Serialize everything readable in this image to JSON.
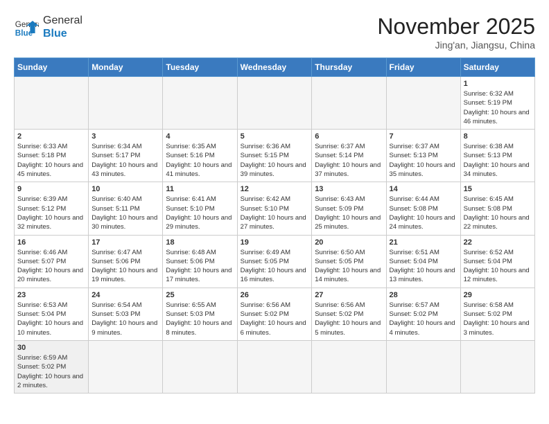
{
  "header": {
    "logo_general": "General",
    "logo_blue": "Blue",
    "month_title": "November 2025",
    "location": "Jing'an, Jiangsu, China"
  },
  "weekdays": [
    "Sunday",
    "Monday",
    "Tuesday",
    "Wednesday",
    "Thursday",
    "Friday",
    "Saturday"
  ],
  "weeks": [
    [
      {
        "day": "",
        "info": ""
      },
      {
        "day": "",
        "info": ""
      },
      {
        "day": "",
        "info": ""
      },
      {
        "day": "",
        "info": ""
      },
      {
        "day": "",
        "info": ""
      },
      {
        "day": "",
        "info": ""
      },
      {
        "day": "1",
        "info": "Sunrise: 6:32 AM\nSunset: 5:19 PM\nDaylight: 10 hours and 46 minutes."
      }
    ],
    [
      {
        "day": "2",
        "info": "Sunrise: 6:33 AM\nSunset: 5:18 PM\nDaylight: 10 hours and 45 minutes."
      },
      {
        "day": "3",
        "info": "Sunrise: 6:34 AM\nSunset: 5:17 PM\nDaylight: 10 hours and 43 minutes."
      },
      {
        "day": "4",
        "info": "Sunrise: 6:35 AM\nSunset: 5:16 PM\nDaylight: 10 hours and 41 minutes."
      },
      {
        "day": "5",
        "info": "Sunrise: 6:36 AM\nSunset: 5:15 PM\nDaylight: 10 hours and 39 minutes."
      },
      {
        "day": "6",
        "info": "Sunrise: 6:37 AM\nSunset: 5:14 PM\nDaylight: 10 hours and 37 minutes."
      },
      {
        "day": "7",
        "info": "Sunrise: 6:37 AM\nSunset: 5:13 PM\nDaylight: 10 hours and 35 minutes."
      },
      {
        "day": "8",
        "info": "Sunrise: 6:38 AM\nSunset: 5:13 PM\nDaylight: 10 hours and 34 minutes."
      }
    ],
    [
      {
        "day": "9",
        "info": "Sunrise: 6:39 AM\nSunset: 5:12 PM\nDaylight: 10 hours and 32 minutes."
      },
      {
        "day": "10",
        "info": "Sunrise: 6:40 AM\nSunset: 5:11 PM\nDaylight: 10 hours and 30 minutes."
      },
      {
        "day": "11",
        "info": "Sunrise: 6:41 AM\nSunset: 5:10 PM\nDaylight: 10 hours and 29 minutes."
      },
      {
        "day": "12",
        "info": "Sunrise: 6:42 AM\nSunset: 5:10 PM\nDaylight: 10 hours and 27 minutes."
      },
      {
        "day": "13",
        "info": "Sunrise: 6:43 AM\nSunset: 5:09 PM\nDaylight: 10 hours and 25 minutes."
      },
      {
        "day": "14",
        "info": "Sunrise: 6:44 AM\nSunset: 5:08 PM\nDaylight: 10 hours and 24 minutes."
      },
      {
        "day": "15",
        "info": "Sunrise: 6:45 AM\nSunset: 5:08 PM\nDaylight: 10 hours and 22 minutes."
      }
    ],
    [
      {
        "day": "16",
        "info": "Sunrise: 6:46 AM\nSunset: 5:07 PM\nDaylight: 10 hours and 20 minutes."
      },
      {
        "day": "17",
        "info": "Sunrise: 6:47 AM\nSunset: 5:06 PM\nDaylight: 10 hours and 19 minutes."
      },
      {
        "day": "18",
        "info": "Sunrise: 6:48 AM\nSunset: 5:06 PM\nDaylight: 10 hours and 17 minutes."
      },
      {
        "day": "19",
        "info": "Sunrise: 6:49 AM\nSunset: 5:05 PM\nDaylight: 10 hours and 16 minutes."
      },
      {
        "day": "20",
        "info": "Sunrise: 6:50 AM\nSunset: 5:05 PM\nDaylight: 10 hours and 14 minutes."
      },
      {
        "day": "21",
        "info": "Sunrise: 6:51 AM\nSunset: 5:04 PM\nDaylight: 10 hours and 13 minutes."
      },
      {
        "day": "22",
        "info": "Sunrise: 6:52 AM\nSunset: 5:04 PM\nDaylight: 10 hours and 12 minutes."
      }
    ],
    [
      {
        "day": "23",
        "info": "Sunrise: 6:53 AM\nSunset: 5:04 PM\nDaylight: 10 hours and 10 minutes."
      },
      {
        "day": "24",
        "info": "Sunrise: 6:54 AM\nSunset: 5:03 PM\nDaylight: 10 hours and 9 minutes."
      },
      {
        "day": "25",
        "info": "Sunrise: 6:55 AM\nSunset: 5:03 PM\nDaylight: 10 hours and 8 minutes."
      },
      {
        "day": "26",
        "info": "Sunrise: 6:56 AM\nSunset: 5:02 PM\nDaylight: 10 hours and 6 minutes."
      },
      {
        "day": "27",
        "info": "Sunrise: 6:56 AM\nSunset: 5:02 PM\nDaylight: 10 hours and 5 minutes."
      },
      {
        "day": "28",
        "info": "Sunrise: 6:57 AM\nSunset: 5:02 PM\nDaylight: 10 hours and 4 minutes."
      },
      {
        "day": "29",
        "info": "Sunrise: 6:58 AM\nSunset: 5:02 PM\nDaylight: 10 hours and 3 minutes."
      }
    ],
    [
      {
        "day": "30",
        "info": "Sunrise: 6:59 AM\nSunset: 5:02 PM\nDaylight: 10 hours and 2 minutes."
      },
      {
        "day": "",
        "info": ""
      },
      {
        "day": "",
        "info": ""
      },
      {
        "day": "",
        "info": ""
      },
      {
        "day": "",
        "info": ""
      },
      {
        "day": "",
        "info": ""
      },
      {
        "day": "",
        "info": ""
      }
    ]
  ]
}
